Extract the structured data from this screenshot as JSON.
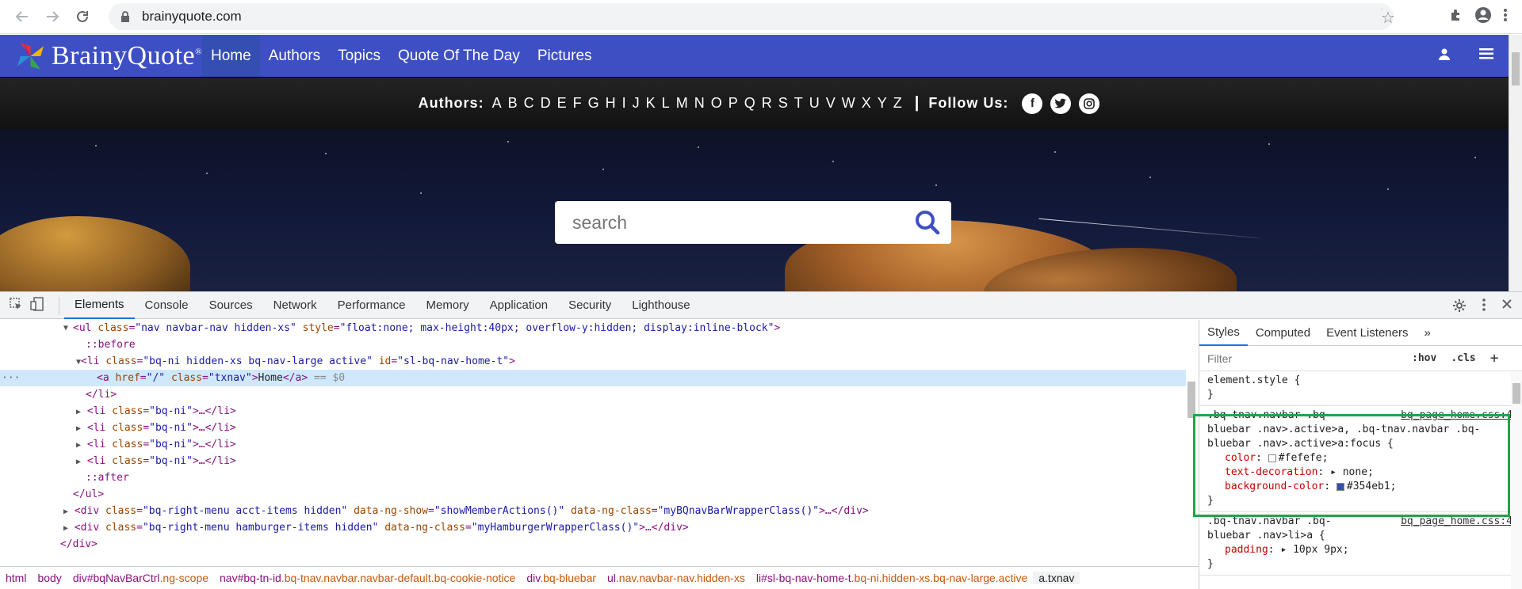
{
  "browser": {
    "url": "brainyquote.com"
  },
  "site": {
    "logo": "BrainyQuote",
    "logo_mark": "®",
    "nav": [
      "Home",
      "Authors",
      "Topics",
      "Quote Of The Day",
      "Pictures"
    ],
    "authors_label": "Authors:",
    "letters": [
      "A",
      "B",
      "C",
      "D",
      "E",
      "F",
      "G",
      "H",
      "I",
      "J",
      "K",
      "L",
      "M",
      "N",
      "O",
      "P",
      "Q",
      "R",
      "S",
      "T",
      "U",
      "V",
      "W",
      "X",
      "Y",
      "Z"
    ],
    "separator": "|",
    "follow_label": "Follow Us:",
    "search_placeholder": "search"
  },
  "devtools": {
    "tabs": [
      "Elements",
      "Console",
      "Sources",
      "Network",
      "Performance",
      "Memory",
      "Application",
      "Security",
      "Lighthouse"
    ],
    "dom": {
      "l1_attrs": "ul class=\"nav navbar-nav hidden-xs\" style=\"float:none; max-height:40px; overflow-y:hidden; display:inline-block\"",
      "before": "::before",
      "l3": "li class=\"bq-ni hidden-xs bq-nav-large active\" id=\"sl-bq-nav-home-t\"",
      "a_open": "<a href=\"/\" class=\"txnav\">",
      "a_text": "Home",
      "a_close": "</a>",
      "a_eq": " == $0",
      "li_close": "</li>",
      "li_collapsed": "<li class=\"bq-ni\">…</li>",
      "after": "::after",
      "ul_close": "</ul>",
      "div1": "<div class=\"bq-right-menu acct-items hidden\" data-ng-show=\"showMemberActions()\" data-ng-class=\"myBQnavBarWrapperClass()\">…</div>",
      "div2": "<div class=\"bq-right-menu hamburger-items hidden\" data-ng-class=\"myHamburgerWrapperClass()\">…</div>",
      "div_close": "</div>"
    },
    "breadcrumbs": [
      {
        "tag": "html",
        "cls": ""
      },
      {
        "tag": "body",
        "cls": ""
      },
      {
        "tag": "div#bqNavBarCtrl",
        "cls": ".ng-scope"
      },
      {
        "tag": "nav#bq-tn-id",
        "cls": ".bq-tnav.navbar.navbar-default.bq-cookie-notice"
      },
      {
        "tag": "div",
        "cls": ".bq-bluebar"
      },
      {
        "tag": "ul",
        "cls": ".nav.navbar-nav.hidden-xs"
      },
      {
        "tag": "li#sl-bq-nav-home-t",
        "cls": ".bq-ni.hidden-xs.bq-nav-large.active"
      },
      {
        "tag": "a.txnav",
        "cls": ""
      }
    ],
    "styles": {
      "tabs": [
        "Styles",
        "Computed",
        "Event Listeners",
        "»"
      ],
      "filter_placeholder": "Filter",
      "hov": ":hov",
      "cls": ".cls",
      "plus": "+",
      "element_style": "element.style {",
      "close_brace": "}",
      "rule1_selector_1": ".bq-tnav.navbar .bq-",
      "rule1_selector_2": "bluebar .nav>.active>a, .bq-tnav.navbar .bq-",
      "rule1_selector_3": "bluebar .nav>.active>a:focus {",
      "rule1_file": "bq_page_home.css:4",
      "rule1_props": [
        {
          "name": "color",
          "value": "#fefefe;",
          "swatch": "#fefefe"
        },
        {
          "name": "text-decoration",
          "value": "▸ none;",
          "swatch": ""
        },
        {
          "name": "background-color",
          "value": "#354eb1;",
          "swatch": "#354eb1"
        }
      ],
      "rule2_selector_1": ".bq-tnav.navbar .bq-",
      "rule2_selector_2": "bluebar .nav>li>a {",
      "rule2_file": "bq_page_home.css:4",
      "rule2_props": [
        {
          "name": "padding",
          "value": "▸ 10px 9px;"
        }
      ]
    }
  },
  "colors": {
    "bluebar": "#3e4fc4",
    "active_nav": "#354eb1",
    "highlight": "#22a447"
  }
}
